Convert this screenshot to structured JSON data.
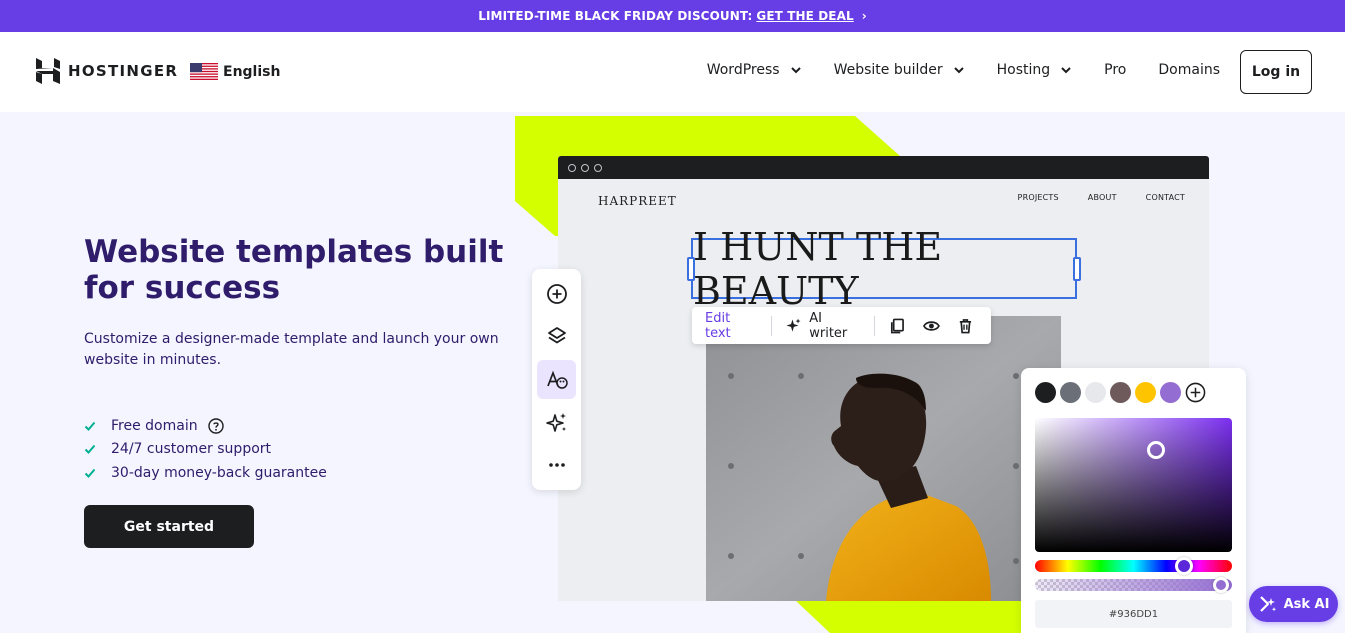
{
  "promo": {
    "text": "LIMITED-TIME BLACK FRIDAY DISCOUNT:",
    "link": "GET THE DEAL",
    "chevron": "›"
  },
  "header": {
    "brand": "HOSTINGER",
    "language": "English",
    "nav": [
      {
        "label": "WordPress",
        "has_dropdown": true
      },
      {
        "label": "Website builder",
        "has_dropdown": true
      },
      {
        "label": "Hosting",
        "has_dropdown": true
      },
      {
        "label": "Pro",
        "has_dropdown": false
      },
      {
        "label": "Domains",
        "has_dropdown": false
      }
    ],
    "login": "Log in"
  },
  "hero": {
    "title": "Website templates built for success",
    "subtitle": "Customize a designer-made template and launch your own website in minutes.",
    "features": [
      "Free domain",
      "24/7 customer support",
      "30-day money-back guarantee"
    ],
    "cta": "Get started"
  },
  "preview": {
    "site_brand": "HARPREET",
    "site_nav": [
      "PROJECTS",
      "ABOUT",
      "CONTACT"
    ],
    "headline": "I HUNT THE BEAUTY",
    "toolbar": {
      "edit_text": "Edit text",
      "ai_writer": "AI writer"
    },
    "side_tools": [
      "add-icon",
      "layers-icon",
      "style-icon",
      "sparkle-icon",
      "more-icon"
    ],
    "color_picker": {
      "swatches": [
        "#1d1e20",
        "#6b6f78",
        "#e7e8ec",
        "#6e5a5a",
        "#ffc400",
        "#936dd1"
      ],
      "hex": "#936DD1"
    }
  },
  "ask_ai": "Ask AI",
  "colors": {
    "brand": "#673de6",
    "lime": "#d4ff00",
    "navy": "#2f1c6a",
    "check": "#00b090"
  }
}
